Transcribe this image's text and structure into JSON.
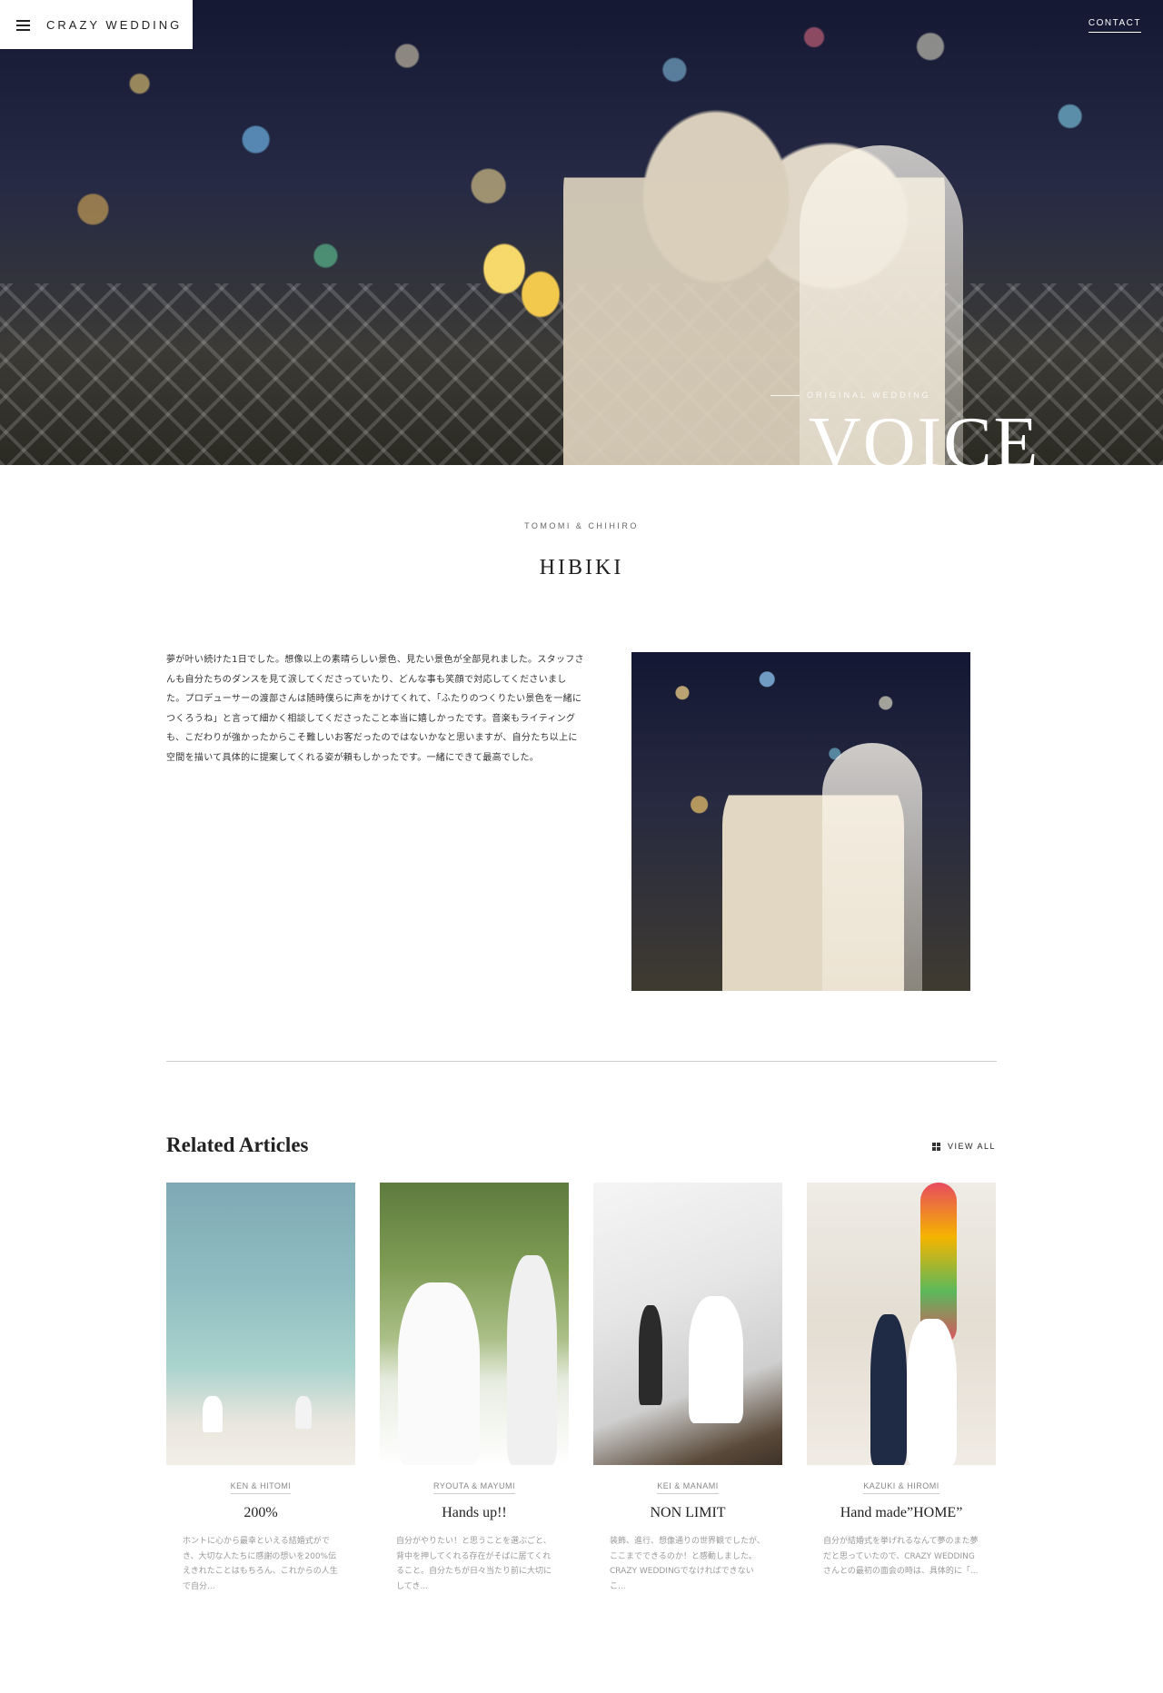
{
  "header": {
    "logo_text": "CRAZY WEDDING",
    "contact_label": "CONTACT"
  },
  "hero": {
    "subtitle": "ORIGINAL WEDDING",
    "title": "VOICE"
  },
  "article": {
    "couple": "TOMOMI & CHIHIRO",
    "title": "HIBIKI",
    "body": "夢が叶い続けた1日でした。想像以上の素晴らしい景色、見たい景色が全部見れました。スタッフさんも自分たちのダンスを見て涙してくださっていたり、どんな事も笑顔で対応してくださいました。プロデューサーの渡部さんは随時僕らに声をかけてくれて、「ふたりのつくりたい景色を一緒につくろうね」と言って細かく相談してくださったこと本当に嬉しかったです。音楽もライティングも、こだわりが強かったからこそ難しいお客だったのではないかなと思いますが、自分たち以上に空間を描いて具体的に提案してくれる姿が頼もしかったです。一緒にできて最高でした。"
  },
  "related": {
    "heading": "Related Articles",
    "view_all": "VIEW ALL",
    "items": [
      {
        "couple": "KEN & HITOMI",
        "title": "200%",
        "excerpt": "ホントに心から最幸といえる結婚式ができ、大切な人たちに感謝の想いを200%伝えきれたことはもちろん、これからの人生で自分..."
      },
      {
        "couple": "RYOUTA & MAYUMI",
        "title": "Hands up!!",
        "excerpt": "自分がやりたい！と思うことを選ぶごと、背中を押してくれる存在がそばに居てくれること。自分たちが日々当たり前に大切にしてき..."
      },
      {
        "couple": "KEI & MANAMI",
        "title": "NON LIMIT",
        "excerpt": "装飾、進行、想像通りの世界観でしたが、ここまでできるのか！と感動しました。CRAZY WEDDINGでなければできないこ..."
      },
      {
        "couple": "KAZUKI & HIROMI",
        "title": "Hand made”HOME”",
        "excerpt": "自分が結婚式を挙げれるなんて夢のまた夢だと思っていたので、CRAZY WEDDINGさんとの最初の面会の時は、具体的に「..."
      }
    ]
  }
}
